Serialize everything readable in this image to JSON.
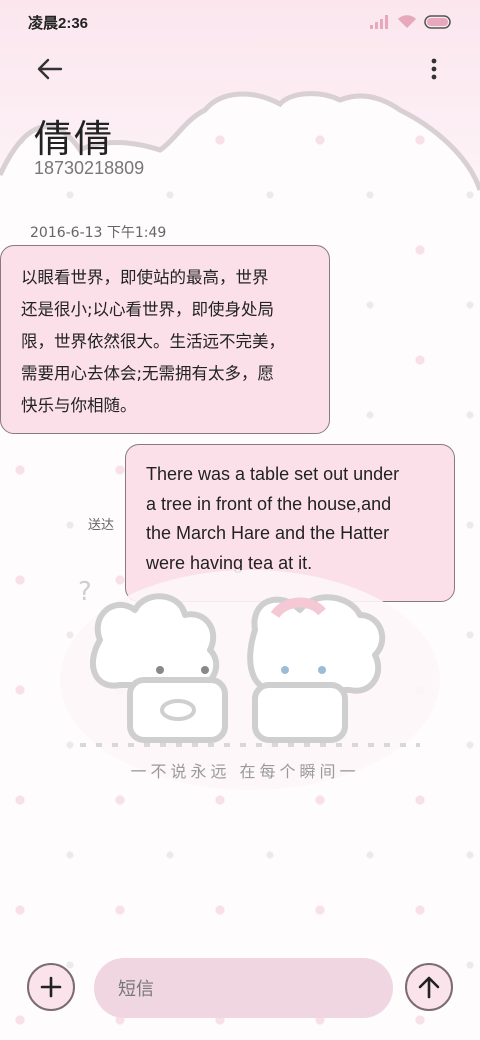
{
  "status_bar": {
    "time": "凌晨2:36",
    "icons": [
      "signal-icon",
      "wifi-icon",
      "battery-icon"
    ]
  },
  "top_bar": {
    "back_icon": "arrow-left-icon",
    "more_icon": "more-vertical-icon"
  },
  "contact": {
    "name": "倩倩",
    "number": "18730218809"
  },
  "conversation": {
    "timestamp": "2016-6-13 下午1:49",
    "messages": [
      {
        "direction": "incoming",
        "lines": [
          "以眼看世界，即使站的最高，世界",
          "还是很小;以心看世界，即使身处局",
          "限，世界依然很大。生活远不完美，",
          "需要用心去体会;无需拥有太多，愿",
          "快乐与你相随。"
        ]
      },
      {
        "direction": "outgoing",
        "lines": [
          "There was a table set out under",
          "a tree in front of the house,and",
          "the March Hare and the Hatter",
          "were having tea at it."
        ],
        "status": "送达"
      }
    ]
  },
  "wallpaper": {
    "caption": "一不说永远 在每个瞬间一"
  },
  "composer": {
    "add_icon": "plus-icon",
    "placeholder": "短信",
    "send_icon": "arrow-up-icon"
  },
  "colors": {
    "bubble": "#fbe0ea",
    "bubble_border": "#8a7a80",
    "input_bg": "#f0d6e0",
    "header_pink": "#fce8ef"
  }
}
